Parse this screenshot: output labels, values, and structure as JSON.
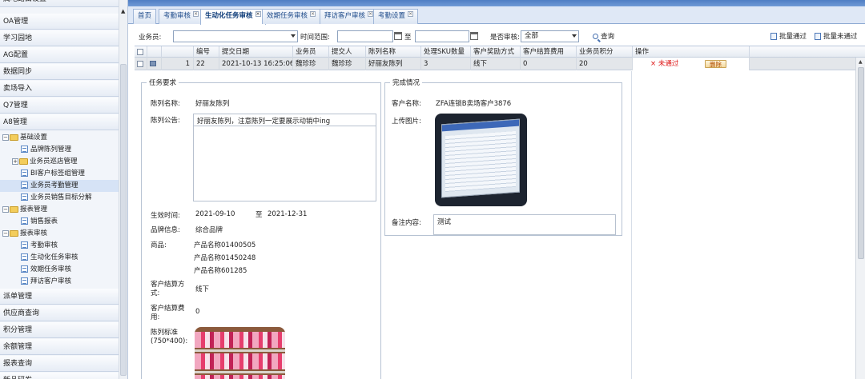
{
  "sidebar": {
    "top_partial": "属地路由设置",
    "menu": [
      "OA管理",
      "学习园地",
      "AG配置",
      "数据同步",
      "卖场导入",
      "Q7管理",
      "A8管理"
    ],
    "tree": {
      "basic": "基础设置",
      "basic_children": [
        "品牌陈列管理",
        "业务员巡店管理",
        "BI客户标签组管理",
        "业务员考勤管理",
        "业务员销售目标分解"
      ],
      "report_mgmt": "报表管理",
      "report_mgmt_children": [
        "销售报表"
      ],
      "report_audit": "报表审核",
      "report_audit_children": [
        "考勤审核",
        "生动化任务审核",
        "效期任务审核",
        "拜访客户审核"
      ]
    },
    "menu_bottom": [
      "派单管理",
      "供应商查询",
      "积分管理",
      "余额管理",
      "报表查询",
      "新品研发"
    ]
  },
  "tabs": [
    {
      "label": "首页",
      "closable": false
    },
    {
      "label": "考勤审核",
      "closable": true
    },
    {
      "label": "生动化任务审核",
      "closable": true,
      "active": true
    },
    {
      "label": "效期任务审核",
      "closable": true
    },
    {
      "label": "拜访客户审核",
      "closable": true
    },
    {
      "label": "考勤设置",
      "closable": true
    }
  ],
  "filter": {
    "salesman_label": "业务员:",
    "salesman_value": "",
    "time_label": "时间范围:",
    "to_label": "至",
    "audited_label": "是否审核:",
    "audited_value": "全部",
    "search": "查询",
    "batch_pass": "批量通过",
    "batch_reject": "批量未通过"
  },
  "grid": {
    "headers": [
      "编号",
      "提交日期",
      "业务员",
      "提交人",
      "陈列名称",
      "处理SKU数量",
      "客户奖励方式",
      "客户结算费用",
      "业务员积分",
      "操作"
    ],
    "row": {
      "index": "1",
      "id": "22",
      "date": "2021-10-13 16:25:06",
      "salesman": "魏珍珍",
      "submitter": "魏珍珍",
      "display_name": "好丽友陈列",
      "sku_count": "3",
      "reward_method": "线下",
      "settle_fee": "0",
      "points": "20",
      "status": "× 未通过",
      "delete_btn": "删除"
    }
  },
  "task": {
    "legend": "任务要求",
    "name_label": "陈列名称:",
    "name_value": "好丽友陈列",
    "notice_label": "陈列公告:",
    "notice_value": "好丽友陈列，注意陈列一定要展示动销中ing",
    "effective_label": "生效时间:",
    "effective_from": "2021-09-10",
    "effective_to_label": "至",
    "effective_to": "2021-12-31",
    "brand_label": "品牌信息:",
    "brand_value": "综合品牌",
    "product_label": "商品:",
    "products": [
      "产品名称01400505",
      "产品名称01450248",
      "产品名称601285"
    ],
    "settle_method_label": "客户结算方式:",
    "settle_method_value": "线下",
    "settle_fee_label": "客户结算费用:",
    "settle_fee_value": "0",
    "standard_label": "陈列标准(750*400):"
  },
  "completion": {
    "legend": "完成情况",
    "customer_label": "客户名称:",
    "customer_value": "ZFA连锁B卖场客户3876",
    "upload_label": "上传图片:",
    "remark_label": "备注内容:",
    "remark_value": "测试"
  }
}
